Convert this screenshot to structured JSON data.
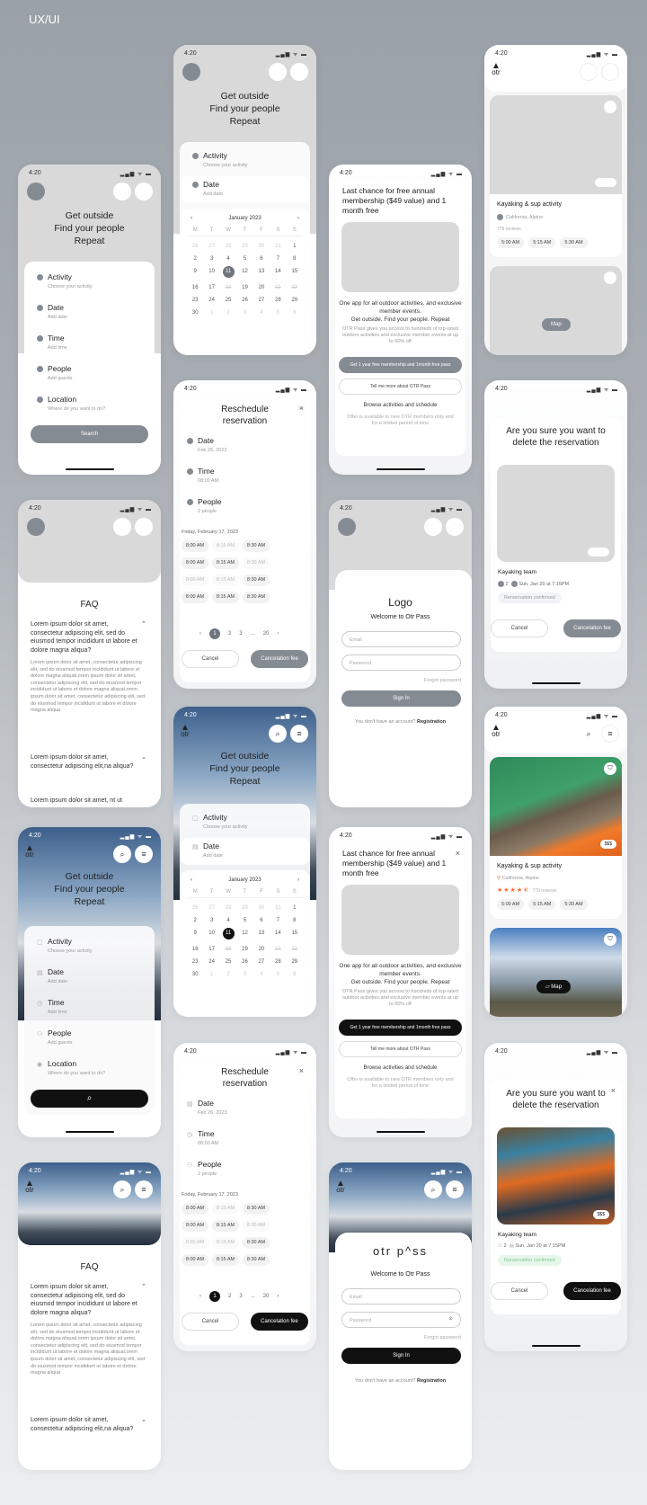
{
  "header": {
    "title": "UX/UI"
  },
  "status": {
    "time": "4:20",
    "signal": "▂▄▆ ᯤ ▬"
  },
  "hero": {
    "line1": "Get outside",
    "line2": "Find your people",
    "line3": "Repeat"
  },
  "search_form": {
    "fields": [
      {
        "label": "Activity",
        "sub": "Choose your activity",
        "icon": "briefcase-icon"
      },
      {
        "label": "Date",
        "sub": "Add date",
        "icon": "calendar-icon"
      },
      {
        "label": "Time",
        "sub": "Add time",
        "icon": "clock-icon"
      },
      {
        "label": "People",
        "sub": "Add guests",
        "icon": "people-icon"
      },
      {
        "label": "Location",
        "sub": "Where do you want to do?",
        "icon": "pin-icon"
      }
    ],
    "search_label": "Search",
    "search_icon": "⌕"
  },
  "calendar": {
    "month": "January 2023",
    "prev": "‹",
    "next": "›",
    "weekdays": [
      "M",
      "T",
      "W",
      "T",
      "F",
      "S",
      "S"
    ],
    "days": [
      "26",
      "27",
      "28",
      "29",
      "30",
      "31",
      "1",
      "2",
      "3",
      "4",
      "5",
      "6",
      "7",
      "8",
      "9",
      "10",
      "11",
      "12",
      "13",
      "14",
      "15",
      "16",
      "17",
      "18",
      "19",
      "20",
      "21",
      "22",
      "23",
      "24",
      "25",
      "26",
      "27",
      "28",
      "29",
      "30",
      "1",
      "2",
      "3",
      "4",
      "5",
      "6"
    ],
    "selected": "11"
  },
  "promo": {
    "title": "Last chance for free annual membership ($49 value) and 1 month free",
    "tagline1": "One app for all outdoor activities, and exclusive member events.",
    "tagline2": "Get outside. Find your people. Repeat",
    "desc": "OTR Pass gives you access to hundreds of top-rated outdoor activities and exclusive member events at up to 60% off",
    "cta": "Get 1 year free membership and 1month free pass",
    "more": "Tell me more about OTR Pass",
    "browse": "Browse activities and schedule",
    "note": "Offer is available to new OTR members only and for a limited period of time",
    "close": "×"
  },
  "listing": {
    "logo": "otr",
    "title": "Kayaking & sup activity",
    "location": "California, Alpine",
    "reviews": "779 reviews",
    "rating": 4.5,
    "stars": "★★★★⯪",
    "times": [
      "5:00 AM",
      "5:15 AM",
      "5:30 AM"
    ],
    "price": "$$$",
    "map": "Map"
  },
  "reschedule": {
    "title1": "Reschedule",
    "title2": "reservation",
    "close": "×",
    "fields": [
      {
        "label": "Date",
        "sub": "Feb 26, 2023"
      },
      {
        "label": "Time",
        "sub": "08:00 AM"
      },
      {
        "label": "People",
        "sub": "2 people"
      }
    ],
    "day": "Friday, February 17, 2023",
    "slots": [
      {
        "t": "8:00 AM",
        "d": false
      },
      {
        "t": "8:15 AM",
        "d": true
      },
      {
        "t": "8:30 AM",
        "d": false
      },
      {
        "t": "8:00 AM",
        "d": false
      },
      {
        "t": "8:15 AM",
        "d": false
      },
      {
        "t": "8:30 AM",
        "d": true
      },
      {
        "t": "8:00 AM",
        "d": true
      },
      {
        "t": "8:15 AM",
        "d": true
      },
      {
        "t": "8:30 AM",
        "d": false
      },
      {
        "t": "8:00 AM",
        "d": false
      },
      {
        "t": "8:15 AM",
        "d": false
      },
      {
        "t": "8:30 AM",
        "d": false
      }
    ],
    "pages": [
      "‹",
      "1",
      "2",
      "3",
      "...",
      "20",
      "›"
    ],
    "current_page": "1",
    "cancel": "Cancel",
    "fee": "Cancelation fee"
  },
  "delete": {
    "title": "Are you sure you want to delete the reservation",
    "team": "Kayaking team",
    "people": "2",
    "when": "Sun, Jan 20 at 7:15PM",
    "status": "Rerservation confirmed",
    "cancel": "Cancel",
    "fee": "Cancelation fee",
    "price": "$$$",
    "close": "×"
  },
  "login": {
    "logo_placeholder": "Logo",
    "brand": "otr p^ss",
    "welcome": "Welcome to Otr Pass",
    "email": "Email",
    "password": "Password",
    "forgot": "Forgot password",
    "signin": "Sign In",
    "no_account": "You don't have an account?",
    "register": "Registration"
  },
  "faq": {
    "title": "FAQ",
    "q1": "Lorem ipsum dolor sit amet, consectetur adipiscing elit, sed do eiusmod tempor incididunt ut labore et dolore magna aliqua?",
    "a1": "Lorem ipsum dolor sit amet, consectetur adipiscing elit, sed do eiusmod tempor incididunt ut labore et dolore magna aliqual.orem ipsum dolor sit amet, consectetur adipiscing elit, sed do eiusmod tempor incididunt ut labore et dolore magna aliqual.orem ipsum dolor sit amet, consectetur adipiscing elit, sed do eiusmod tempor incididunt ut labore et dolore magna aliqua",
    "q2": "Lorem ipsum dolor sit amet, consectetur adipiscing elit,na aliqua?",
    "q3": "Lorem ipsum dolor sit amet, nt ut",
    "up": "⌃",
    "down": "⌄"
  },
  "colors": {
    "gray_accent": "#858b93",
    "black_accent": "#111111",
    "orange": "#ff6a2b",
    "green_badge": "#e6f6ea"
  }
}
